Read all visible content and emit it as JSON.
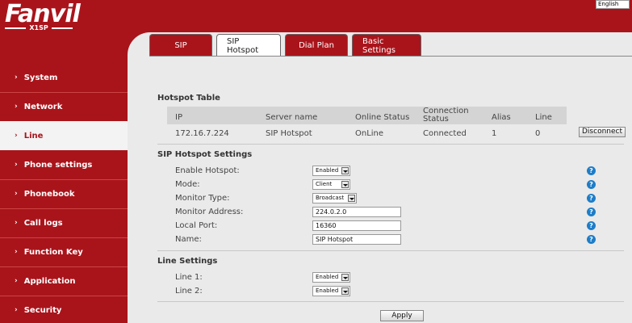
{
  "header": {
    "brand": "Fanvil",
    "model": "X1SP",
    "language": "English"
  },
  "sidebar": {
    "items": [
      {
        "label": "System"
      },
      {
        "label": "Network"
      },
      {
        "label": "Line"
      },
      {
        "label": "Phone settings"
      },
      {
        "label": "Phonebook"
      },
      {
        "label": "Call logs"
      },
      {
        "label": "Function Key"
      },
      {
        "label": "Application"
      },
      {
        "label": "Security"
      }
    ],
    "active_index": 2,
    "arrow": "›"
  },
  "tabs": [
    {
      "label": "SIP"
    },
    {
      "label": "SIP Hotspot"
    },
    {
      "label": "Dial Plan"
    },
    {
      "label": "Basic Settings"
    }
  ],
  "hotspot_table": {
    "title": "Hotspot Table",
    "headers": [
      "IP",
      "Server name",
      "Online Status",
      "Connection Status",
      "Alias",
      "Line"
    ],
    "row": [
      "172.16.7.224",
      "SIP Hotspot",
      "OnLine",
      "Connected",
      "1",
      "0"
    ],
    "action_label": "Disconnect"
  },
  "sip_hotspot_settings": {
    "title": "SIP Hotspot Settings",
    "enable_hotspot": {
      "label": "Enable Hotspot:",
      "value": "Enabled"
    },
    "mode": {
      "label": "Mode:",
      "value": "Client"
    },
    "monitor_type": {
      "label": "Monitor Type:",
      "value": "Broadcast"
    },
    "monitor_address": {
      "label": "Monitor Address:",
      "value": "224.0.2.0"
    },
    "local_port": {
      "label": "Local Port:",
      "value": "16360"
    },
    "name": {
      "label": "Name:",
      "value": "SIP Hotspot"
    },
    "help_icon": "question-icon"
  },
  "line_settings": {
    "title": "Line Settings",
    "line1": {
      "label": "Line 1:",
      "value": "Enabled"
    },
    "line2": {
      "label": "Line 2:",
      "value": "Enabled"
    }
  },
  "apply_label": "Apply",
  "colors": {
    "brand_red": "#a9141b",
    "help_blue": "#1e7dc8",
    "background": "#eaeaea"
  }
}
